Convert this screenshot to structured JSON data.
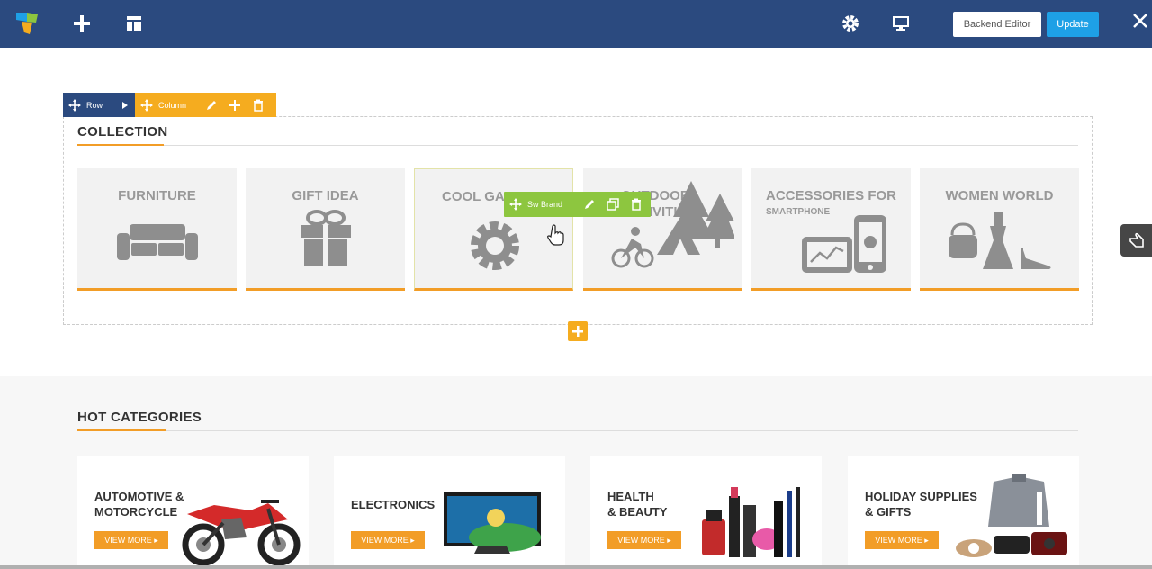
{
  "topbar": {
    "backend_label": "Backend Editor",
    "update_label": "Update",
    "icons": [
      "logo-icon",
      "add-element-icon",
      "templates-icon",
      "settings-icon",
      "responsive-icon",
      "close-icon"
    ]
  },
  "row_controls": {
    "row_label": "Row",
    "column_label": "Column"
  },
  "element_controls": {
    "label": "Sw Brand"
  },
  "collection": {
    "title": "COLLECTION",
    "cards": [
      {
        "title": "FURNITURE",
        "subtitle": "",
        "icon": "sofa-icon"
      },
      {
        "title": "GIFT IDEA",
        "subtitle": "",
        "icon": "gift-icon"
      },
      {
        "title": "COOL GADGETS",
        "subtitle": "",
        "icon": "gear-icon"
      },
      {
        "title": "OUTDOOR ACTIVITIES",
        "subtitle": "",
        "icon": "camping-icon"
      },
      {
        "title": "ACCESSORIES FOR",
        "subtitle": "SMARTPHONE",
        "icon": "devices-icon"
      },
      {
        "title": "WOMEN WORLD",
        "subtitle": "",
        "icon": "fashion-icon"
      }
    ]
  },
  "hot": {
    "title": "HOT CATEGORIES",
    "view_more": "VIEW MORE",
    "cards": [
      {
        "line1": "AUTOMOTIVE &",
        "line2": "MOTORCYCLE",
        "image": "motorcycle-image"
      },
      {
        "line1": "ELECTRONICS",
        "line2": "",
        "image": "tv-image"
      },
      {
        "line1": "HEALTH",
        "line2": "& BEAUTY",
        "image": "cosmetics-image"
      },
      {
        "line1": "HOLIDAY SUPPLIES",
        "line2": "& GIFTS",
        "image": "gifts-image"
      }
    ]
  },
  "colors": {
    "topbar": "#2b4a7f",
    "accent": "#f29d27",
    "column_ctrl": "#f5ac1f",
    "element_ctrl": "#8dc63f",
    "update": "#1ea0e6"
  }
}
